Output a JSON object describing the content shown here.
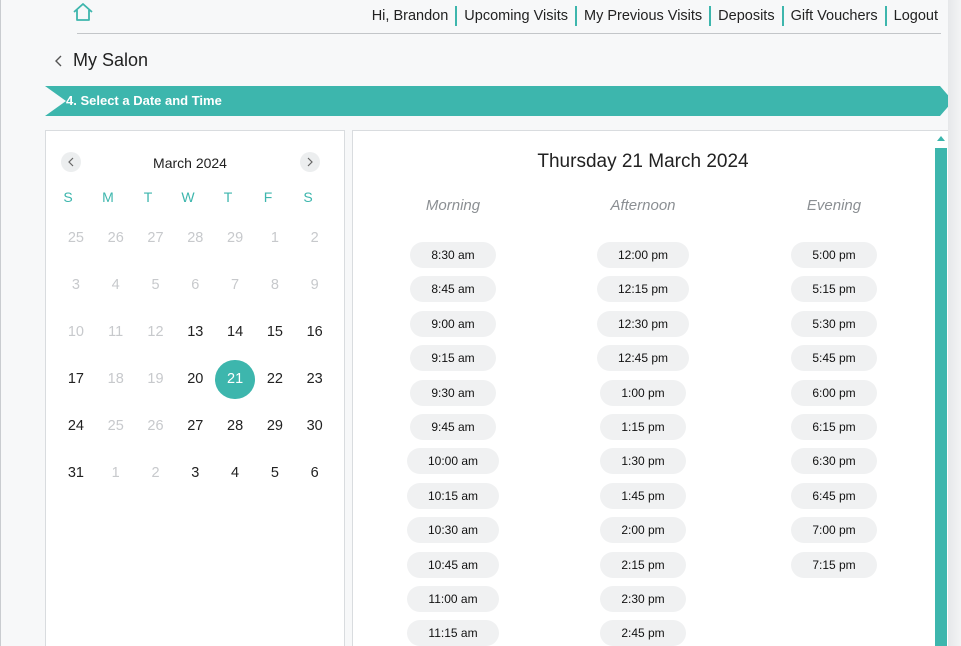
{
  "nav": {
    "greeting": "Hi, Brandon",
    "links": [
      "Upcoming Visits",
      "My Previous Visits",
      "Deposits",
      "Gift Vouchers",
      "Logout"
    ]
  },
  "back": {
    "label": "My Salon"
  },
  "step": {
    "title": "4. Select a Date and Time"
  },
  "calendar": {
    "month": "March 2024",
    "weekdays": [
      "S",
      "M",
      "T",
      "W",
      "T",
      "F",
      "S"
    ],
    "weeks": [
      [
        {
          "d": "25",
          "m": true
        },
        {
          "d": "26",
          "m": true
        },
        {
          "d": "27",
          "m": true
        },
        {
          "d": "28",
          "m": true
        },
        {
          "d": "29",
          "m": true
        },
        {
          "d": "1",
          "m": true
        },
        {
          "d": "2",
          "m": true
        }
      ],
      [
        {
          "d": "3",
          "m": true
        },
        {
          "d": "4",
          "m": true
        },
        {
          "d": "5",
          "m": true
        },
        {
          "d": "6",
          "m": true
        },
        {
          "d": "7",
          "m": true
        },
        {
          "d": "8",
          "m": true
        },
        {
          "d": "9",
          "m": true
        }
      ],
      [
        {
          "d": "10",
          "m": true
        },
        {
          "d": "11",
          "m": true
        },
        {
          "d": "12",
          "m": true
        },
        {
          "d": "13"
        },
        {
          "d": "14"
        },
        {
          "d": "15"
        },
        {
          "d": "16"
        }
      ],
      [
        {
          "d": "17"
        },
        {
          "d": "18",
          "m": true
        },
        {
          "d": "19",
          "m": true
        },
        {
          "d": "20"
        },
        {
          "d": "21",
          "s": true
        },
        {
          "d": "22"
        },
        {
          "d": "23"
        }
      ],
      [
        {
          "d": "24"
        },
        {
          "d": "25",
          "m": true
        },
        {
          "d": "26",
          "m": true
        },
        {
          "d": "27"
        },
        {
          "d": "28"
        },
        {
          "d": "29"
        },
        {
          "d": "30"
        }
      ],
      [
        {
          "d": "31"
        },
        {
          "d": "1",
          "m": true
        },
        {
          "d": "2",
          "m": true
        },
        {
          "d": "3"
        },
        {
          "d": "4"
        },
        {
          "d": "5"
        },
        {
          "d": "6"
        }
      ]
    ]
  },
  "times": {
    "date_title": "Thursday 21 March 2024",
    "columns": [
      {
        "key": "morning",
        "label": "Morning",
        "slots": [
          "8:30 am",
          "8:45 am",
          "9:00 am",
          "9:15 am",
          "9:30 am",
          "9:45 am",
          "10:00 am",
          "10:15 am",
          "10:30 am",
          "10:45 am",
          "11:00 am",
          "11:15 am"
        ]
      },
      {
        "key": "afternoon",
        "label": "Afternoon",
        "slots": [
          "12:00 pm",
          "12:15 pm",
          "12:30 pm",
          "12:45 pm",
          "1:00 pm",
          "1:15 pm",
          "1:30 pm",
          "1:45 pm",
          "2:00 pm",
          "2:15 pm",
          "2:30 pm",
          "2:45 pm"
        ]
      },
      {
        "key": "evening",
        "label": "Evening",
        "slots": [
          "5:00 pm",
          "5:15 pm",
          "5:30 pm",
          "5:45 pm",
          "6:00 pm",
          "6:15 pm",
          "6:30 pm",
          "6:45 pm",
          "7:00 pm",
          "7:15 pm"
        ]
      }
    ]
  },
  "colors": {
    "accent": "#3db6ad",
    "muted_day": "#c7c9cc",
    "slot_bg": "#f0f1f2"
  },
  "icons": {
    "home": "home-icon",
    "back": "chevron-left-icon",
    "prev": "chevron-left-icon",
    "next": "chevron-right-icon"
  }
}
